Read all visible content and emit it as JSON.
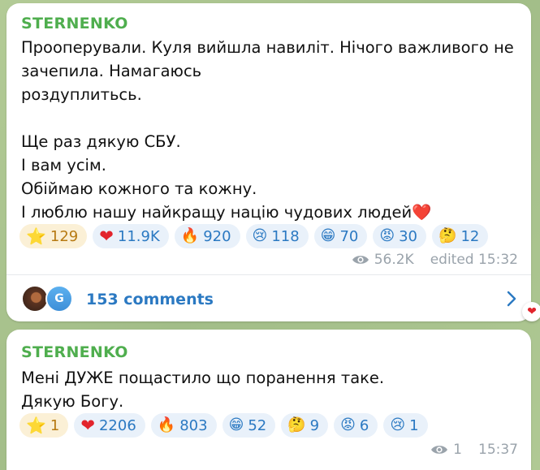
{
  "messages": [
    {
      "sender": "STERNENKO",
      "text": "Прооперували. Куля вийшла навиліт. Нічого важливого не\nзачепила. Намагаюсь\nроздуплитьсь.\n\nЩе раз дякую СБУ.\nІ вам усім.\nОбіймаю кожного та кожну.\nІ люблю нашу найкращу націю чудових людей❤️",
      "reactions": [
        {
          "emoji": "⭐",
          "count": "129"
        },
        {
          "emoji": "❤",
          "count": "11.9K"
        },
        {
          "emoji": "🔥",
          "count": "920"
        },
        {
          "emoji": "😢",
          "count": "118"
        },
        {
          "emoji": "😁",
          "count": "70"
        },
        {
          "emoji": "😡",
          "count": "30"
        },
        {
          "emoji": "🤔",
          "count": "12"
        }
      ],
      "views": "56.2K",
      "time": "edited 15:32",
      "comments": {
        "label": "153 comments",
        "avatar_letter": "G"
      }
    },
    {
      "sender": "STERNENKO",
      "text": "Мені ДУЖЕ пощастило що поранення таке.\nДякую Богу.",
      "reactions": [
        {
          "emoji": "⭐",
          "count": "1"
        },
        {
          "emoji": "❤",
          "count": "2206"
        },
        {
          "emoji": "🔥",
          "count": "803"
        },
        {
          "emoji": "😁",
          "count": "52"
        },
        {
          "emoji": "🤔",
          "count": "9"
        },
        {
          "emoji": "😡",
          "count": "6"
        },
        {
          "emoji": "😢",
          "count": "1"
        }
      ],
      "views": "1",
      "time": "15:37"
    }
  ],
  "floating_reaction": {
    "emoji": "❤"
  },
  "colors": {
    "sender": "#4fae4e",
    "link": "#2b79c2",
    "background": "#a9c38f"
  }
}
